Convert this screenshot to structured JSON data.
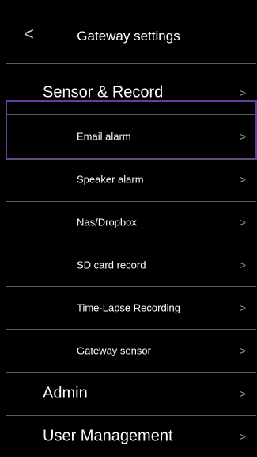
{
  "header": {
    "back_icon": "chevron-left-icon",
    "back_glyph": "<",
    "title": "Gateway settings"
  },
  "menu": {
    "sensor_record": {
      "label": "Sensor & Record",
      "chevron": ">"
    },
    "email_alarm": {
      "label": "Email alarm",
      "chevron": ">"
    },
    "speaker_alarm": {
      "label": "Speaker alarm",
      "chevron": ">"
    },
    "nas_dropbox": {
      "label": "Nas/Dropbox",
      "chevron": ">"
    },
    "sd_card_record": {
      "label": "SD card record",
      "chevron": ">"
    },
    "time_lapse": {
      "label": "Time-Lapse Recording",
      "chevron": ">"
    },
    "gateway_sensor": {
      "label": "Gateway sensor",
      "chevron": ">"
    },
    "admin": {
      "label": "Admin",
      "chevron": ">"
    },
    "user_management": {
      "label": "User Management",
      "chevron": ">"
    }
  },
  "colors": {
    "background": "#000000",
    "divider": "#5a5a5a",
    "selection_border": "#6b3aa0",
    "chevron": "#9a9a9a"
  }
}
